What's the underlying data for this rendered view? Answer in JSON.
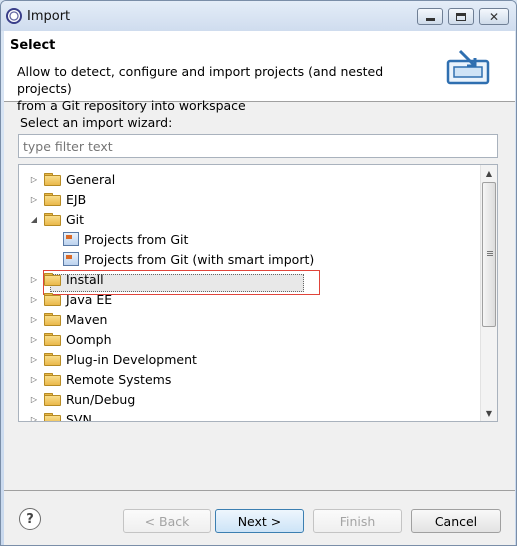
{
  "window": {
    "title": "Import"
  },
  "header": {
    "title": "Select",
    "description_line1": "Allow to detect, configure and import projects (and nested projects)",
    "description_line2": "from a Git repository into workspace"
  },
  "wizard_label": "Select an import wizard:",
  "filter": {
    "placeholder": "type filter text",
    "value": ""
  },
  "tree": {
    "items": [
      {
        "label": "General",
        "expanded": false,
        "level": 0,
        "type": "folder"
      },
      {
        "label": "EJB",
        "expanded": false,
        "level": 0,
        "type": "folder"
      },
      {
        "label": "Git",
        "expanded": true,
        "level": 0,
        "type": "folder"
      },
      {
        "label": "Projects from Git",
        "level": 1,
        "type": "wizard"
      },
      {
        "label": "Projects from Git (with smart import)",
        "level": 1,
        "type": "wizard",
        "selected": true
      },
      {
        "label": "Install",
        "expanded": false,
        "level": 0,
        "type": "folder"
      },
      {
        "label": "Java EE",
        "expanded": false,
        "level": 0,
        "type": "folder"
      },
      {
        "label": "Maven",
        "expanded": false,
        "level": 0,
        "type": "folder"
      },
      {
        "label": "Oomph",
        "expanded": false,
        "level": 0,
        "type": "folder"
      },
      {
        "label": "Plug-in Development",
        "expanded": false,
        "level": 0,
        "type": "folder"
      },
      {
        "label": "Remote Systems",
        "expanded": false,
        "level": 0,
        "type": "folder"
      },
      {
        "label": "Run/Debug",
        "expanded": false,
        "level": 0,
        "type": "folder"
      },
      {
        "label": "SVN",
        "expanded": false,
        "level": 0,
        "type": "folder"
      }
    ]
  },
  "buttons": {
    "help": "?",
    "back": "< Back",
    "next": "Next >",
    "finish": "Finish",
    "cancel": "Cancel"
  },
  "colors": {
    "selection_outline": "#e0443a",
    "default_button": "#3c7fb1"
  }
}
